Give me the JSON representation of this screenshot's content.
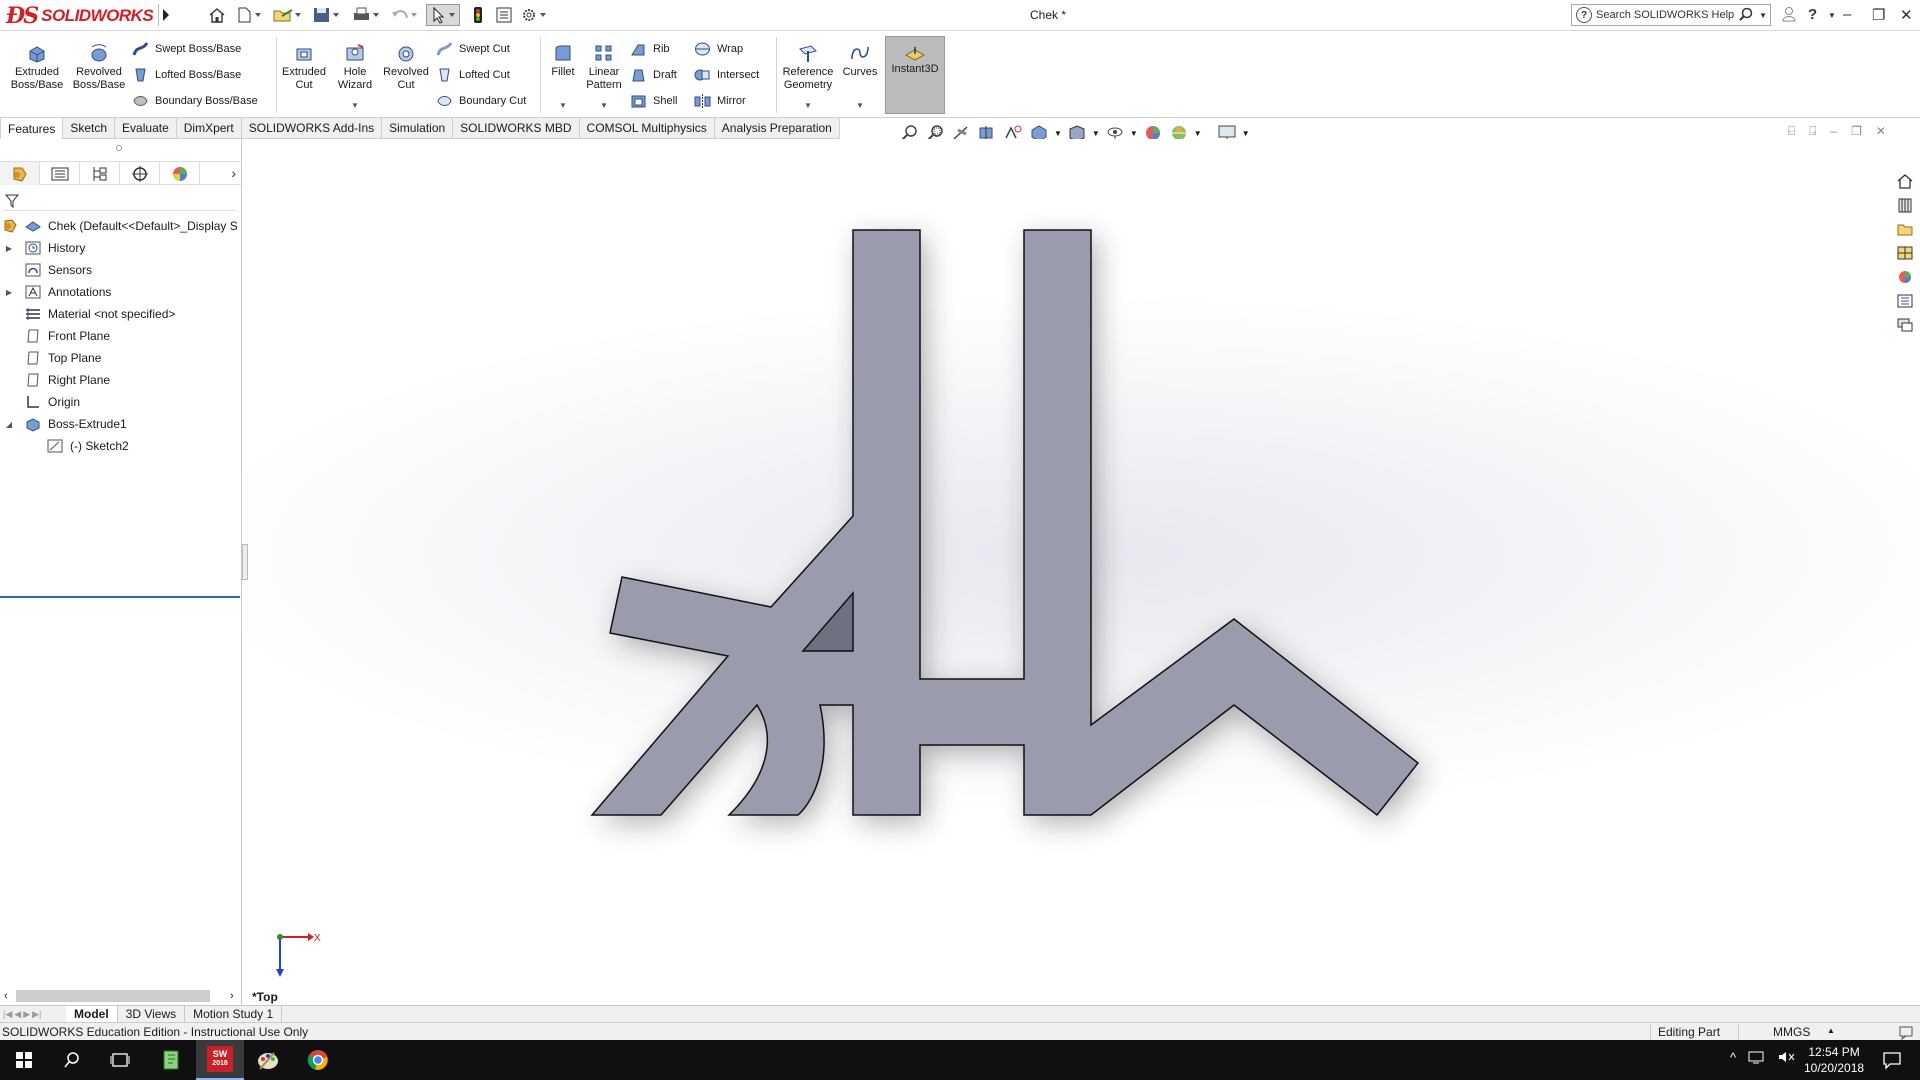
{
  "app": {
    "brand": "SOLIDWORKS",
    "document_title": "Chek *",
    "search_placeholder": "Search SOLIDWORKS Help"
  },
  "command_manager": {
    "extruded_boss": "Extruded Boss/Base",
    "revolved_boss": "Revolved Boss/Base",
    "swept_boss": "Swept Boss/Base",
    "lofted_boss": "Lofted Boss/Base",
    "boundary_boss": "Boundary Boss/Base",
    "extruded_cut": "Extruded Cut",
    "hole_wizard": "Hole Wizard",
    "revolved_cut": "Revolved Cut",
    "swept_cut": "Swept Cut",
    "lofted_cut": "Lofted Cut",
    "boundary_cut": "Boundary Cut",
    "fillet": "Fillet",
    "linear_pattern": "Linear Pattern",
    "rib": "Rib",
    "draft": "Draft",
    "shell": "Shell",
    "wrap": "Wrap",
    "intersect": "Intersect",
    "mirror": "Mirror",
    "reference_geometry": "Reference Geometry",
    "curves": "Curves",
    "instant3d": "Instant3D"
  },
  "tabs": [
    "Features",
    "Sketch",
    "Evaluate",
    "DimXpert",
    "SOLIDWORKS Add-Ins",
    "Simulation",
    "SOLIDWORKS MBD",
    "COMSOL Multiphysics",
    "Analysis Preparation"
  ],
  "feature_tree": {
    "root": "Chek  (Default<<Default>_Display S",
    "items": [
      "History",
      "Sensors",
      "Annotations",
      "Material <not specified>",
      "Front Plane",
      "Top Plane",
      "Right Plane",
      "Origin",
      "Boss-Extrude1",
      "(-) Sketch2"
    ]
  },
  "graphics": {
    "view_label": "*Top",
    "triad_x": "X",
    "part_color": "#9a9cae"
  },
  "bottom_tabs": [
    "Model",
    "3D Views",
    "Motion Study 1"
  ],
  "status": {
    "edition": "SOLIDWORKS Education Edition - Instructional Use Only",
    "mode": "Editing Part",
    "units": "MMGS"
  },
  "taskbar": {
    "time": "12:54 PM",
    "date": "10/20/2018",
    "sw_badge": "2018"
  },
  "colors": {
    "brand_red": "#d31f26",
    "selection_blue": "#2e63b8"
  }
}
